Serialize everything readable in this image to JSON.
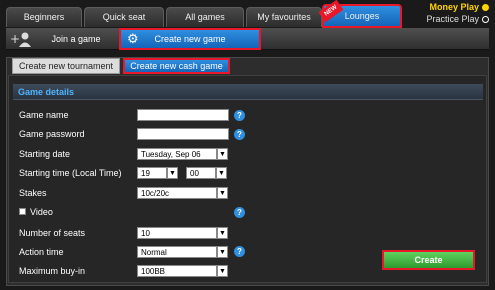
{
  "tabs": [
    {
      "label": "Beginners"
    },
    {
      "label": "Quick seat"
    },
    {
      "label": "All games"
    },
    {
      "label": "My favourites"
    },
    {
      "label": "Lounges",
      "badge": "NEW"
    }
  ],
  "top_right": {
    "money_play": "Money Play",
    "practice_play": "Practice Play"
  },
  "subnav": {
    "join_game": "Join a game",
    "create_new_game": "Create new game"
  },
  "create_tabs": {
    "tournament": "Create new tournament",
    "cash_game": "Create new cash game"
  },
  "section": {
    "title": "Game details"
  },
  "form": {
    "game_name": {
      "label": "Game name",
      "value": ""
    },
    "game_password": {
      "label": "Game password",
      "value": ""
    },
    "starting_date": {
      "label": "Starting date",
      "value": "Tuesday, Sep 06"
    },
    "starting_time": {
      "label": "Starting time (Local Time)",
      "hour": "19",
      "minute": "00"
    },
    "stakes": {
      "label": "Stakes",
      "value": "10c/20c"
    },
    "video": {
      "label": "Video"
    },
    "number_of_seats": {
      "label": "Number of seats",
      "value": "10"
    },
    "action_time": {
      "label": "Action time",
      "value": "Normal"
    },
    "maximum_buy_in": {
      "label": "Maximum buy-in",
      "value": "100BB"
    }
  },
  "create_button": {
    "label": "Create"
  },
  "help_glyph": "?",
  "arrow_glyph": "▼",
  "colors": {
    "accent_blue": "#1e7fd8",
    "highlight_red": "#e8182a",
    "create_green": "#3db83d",
    "section_title_blue": "#4fb4ff"
  }
}
